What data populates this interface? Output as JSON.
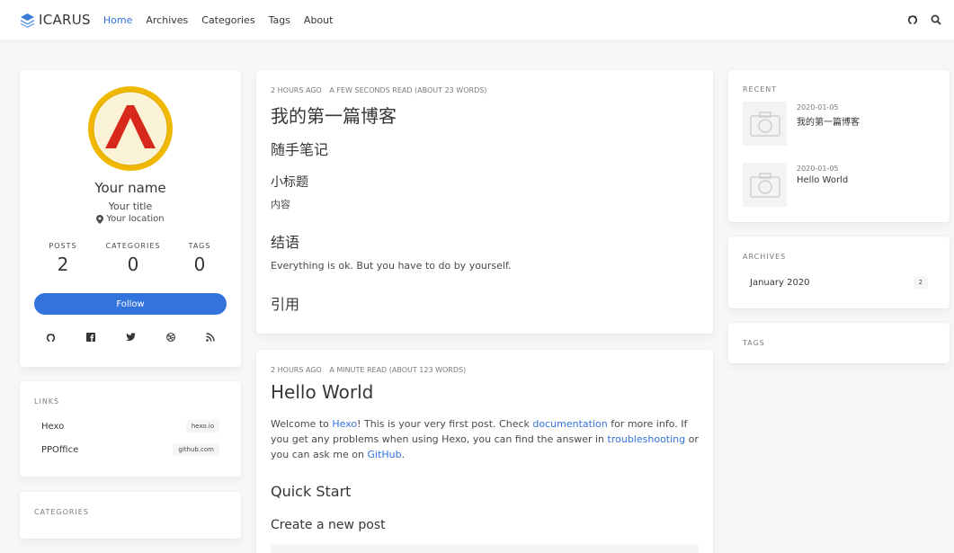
{
  "nav": {
    "brand": "ICARUS",
    "items": [
      "Home",
      "Archives",
      "Categories",
      "Tags",
      "About"
    ],
    "active": "Home",
    "right_icons": [
      "github-icon",
      "search-icon"
    ]
  },
  "profile": {
    "name": "Your name",
    "title": "Your title",
    "location": "Your location",
    "stats": [
      {
        "label": "POSTS",
        "value": "2"
      },
      {
        "label": "CATEGORIES",
        "value": "0"
      },
      {
        "label": "TAGS",
        "value": "0"
      }
    ],
    "follow_label": "Follow",
    "socials": [
      "github-icon",
      "facebook-icon",
      "twitter-icon",
      "dribbble-icon",
      "rss-icon"
    ]
  },
  "links": {
    "label": "LINKS",
    "items": [
      {
        "name": "Hexo",
        "host": "hexo.io"
      },
      {
        "name": "PPOffice",
        "host": "github.com"
      }
    ]
  },
  "categories": {
    "label": "CATEGORIES"
  },
  "posts": [
    {
      "date": "2 HOURS AGO",
      "read": "A FEW SECONDS READ (ABOUT 23 WORDS)",
      "title": "我的第一篇博客",
      "h2": "随手笔记",
      "h3": "小标题",
      "p1": "内容",
      "h3b": "结语",
      "p2": "Everything is ok. But you have to do by yourself.",
      "h3c": "引用"
    },
    {
      "date": "2 HOURS AGO",
      "read": "A MINUTE READ (ABOUT 123 WORDS)",
      "title": "Hello World",
      "body": {
        "t1": "Welcome to ",
        "l1": "Hexo",
        "t2": "! This is your very first post. Check ",
        "l2": "documentation",
        "t3": " for more info. If you get any problems when using Hexo, you can find the answer in ",
        "l3": "troubleshooting",
        "t4": " or you can ask me on ",
        "l4": "GitHub",
        "t5": "."
      },
      "h2": "Quick Start",
      "h3": "Create a new post"
    }
  ],
  "recent": {
    "label": "RECENT",
    "items": [
      {
        "date": "2020-01-05",
        "title": "我的第一篇博客"
      },
      {
        "date": "2020-01-05",
        "title": "Hello World"
      }
    ]
  },
  "archives": {
    "label": "ARCHIVES",
    "items": [
      {
        "month": "January 2020",
        "count": "2"
      }
    ]
  },
  "tags": {
    "label": "TAGS"
  },
  "colors": {
    "accent": "#3273dc",
    "logo_red": "#d8281c",
    "logo_gold": "#f0b800"
  }
}
